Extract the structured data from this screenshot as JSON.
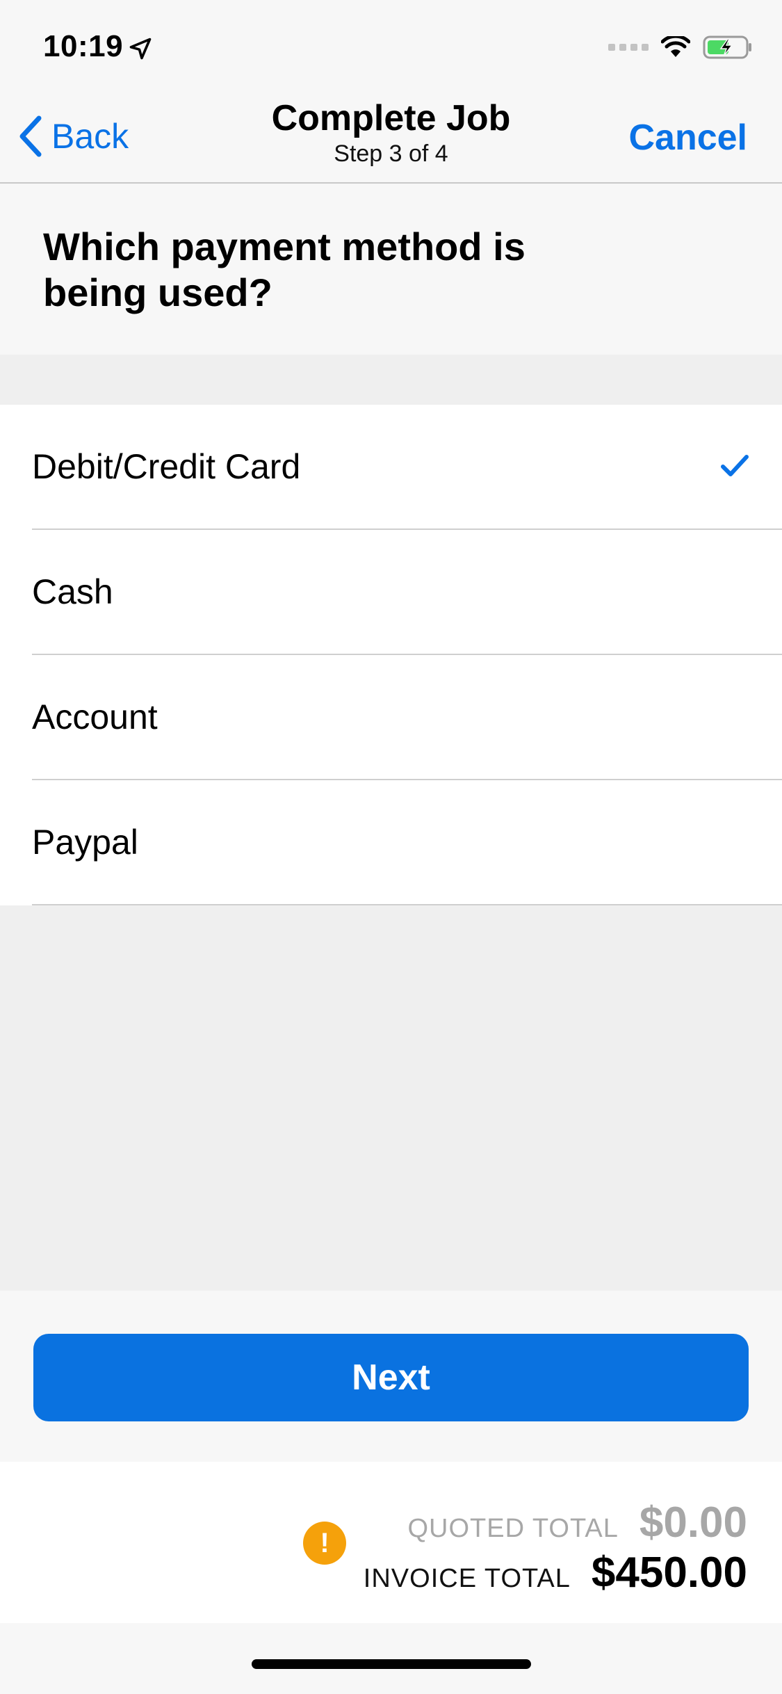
{
  "status_bar": {
    "time": "10:19",
    "icons": [
      "location-arrow-icon",
      "signal-icon",
      "wifi-icon",
      "battery-charging-icon"
    ]
  },
  "nav": {
    "back_label": "Back",
    "title": "Complete Job",
    "subtitle": "Step 3 of 4",
    "cancel_label": "Cancel"
  },
  "question": "Which payment method is being used?",
  "options": [
    {
      "label": "Debit/Credit Card",
      "selected": true
    },
    {
      "label": "Cash",
      "selected": false
    },
    {
      "label": "Account",
      "selected": false
    },
    {
      "label": "Paypal",
      "selected": false
    }
  ],
  "next_label": "Next",
  "totals": {
    "quoted_label": "QUOTED TOTAL",
    "quoted_value": "$0.00",
    "invoice_label": "INVOICE TOTAL",
    "invoice_value": "$450.00",
    "warning_icon": "warning-icon"
  },
  "colors": {
    "accent": "#0a72e6",
    "warning": "#f5a10b",
    "muted": "#a7a7a7"
  }
}
